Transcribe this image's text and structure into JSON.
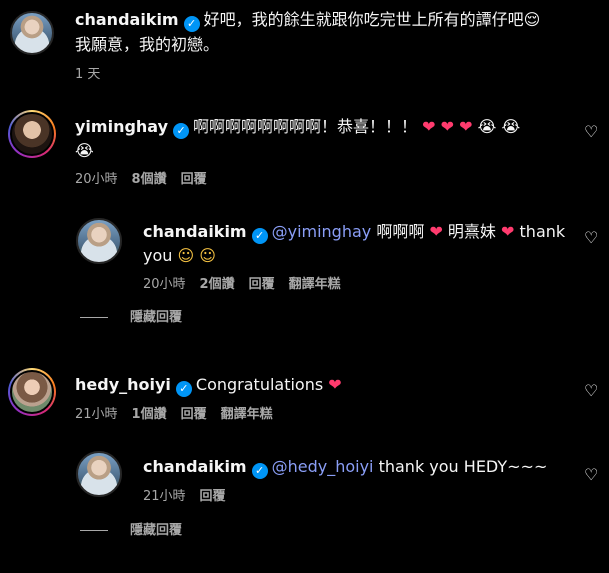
{
  "comments": [
    {
      "user": "chandaikim",
      "text_line1": "好吧，我的餘生就跟你吃完世上所有的譚仔吧",
      "text_line2": "我願意，我的初戀。",
      "time": "1 天"
    },
    {
      "user": "yiminghay",
      "text_line1": "啊啊啊啊啊啊啊啊！恭喜！！！",
      "time": "20小時",
      "likes": "8個讚",
      "reply": "回覆"
    },
    {
      "user": "chandaikim",
      "mention": "@yiminghay",
      "text_a": " 啊啊啊",
      "text_b": " 明熹妹",
      "text_c": " thank",
      "text_line2": "you",
      "time": "20小時",
      "likes": "2個讚",
      "reply": "回覆",
      "translate": "翻譯年糕"
    },
    {
      "user": "hedy_hoiyi",
      "text_line1": "Congratulations",
      "time": "21小時",
      "likes": "1個讚",
      "reply": "回覆",
      "translate": "翻譯年糕"
    },
    {
      "user": "chandaikim",
      "mention": "@hedy_hoiyi",
      "text_line1": " thank you HEDY~~~",
      "time": "21小時",
      "reply": "回覆"
    }
  ],
  "hide_replies_label": "隱藏回覆",
  "icons": {
    "verified": "✓",
    "heart_outline": "♡",
    "heart_red": "❤",
    "smile": "☺",
    "cry": "😭"
  }
}
